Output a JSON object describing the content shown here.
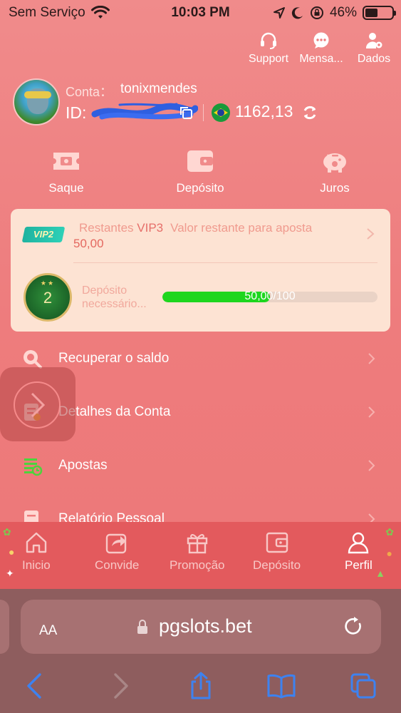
{
  "status_bar": {
    "carrier": "Sem Serviço",
    "time": "10:03 PM",
    "battery": "46%",
    "battery_level": 0.46
  },
  "top_actions": [
    {
      "label": "Support",
      "icon": "headset-icon"
    },
    {
      "label": "Mensa...",
      "icon": "chat-bubble-icon"
    },
    {
      "label": "Dados",
      "icon": "user-settings-icon"
    }
  ],
  "profile": {
    "account_label": "Conta：",
    "account_name": "tonixmendes",
    "id_label": "ID: ",
    "balance": "1162,13",
    "currency_flag": "brazil-flag-icon"
  },
  "quick_actions": [
    {
      "label": "Saque",
      "icon": "ticket-icon"
    },
    {
      "label": "Depósito",
      "icon": "wallet-icon"
    },
    {
      "label": "Juros",
      "icon": "piggy-bank-icon"
    }
  ],
  "vip": {
    "badge": "VIP2",
    "remaining_label": "Restantes",
    "next_level": "VIP3",
    "bet_label": "Valor restante para aposta",
    "amount": "50,00",
    "medal_level": "2",
    "deposit_label": "Depósito necessário...",
    "progress_text": "50,00/100",
    "progress_fraction": 0.5
  },
  "menu": [
    {
      "label": "Recuperar o saldo",
      "icon": "search-coin-icon"
    },
    {
      "label": "Detalhes da Conta",
      "icon": "document-icon"
    },
    {
      "label": "Apostas",
      "icon": "bets-list-icon"
    },
    {
      "label": "Relatório Pessoal",
      "icon": "report-icon"
    }
  ],
  "bottom_nav": [
    {
      "label": "Inicio",
      "icon": "home-icon"
    },
    {
      "label": "Convide",
      "icon": "share-icon"
    },
    {
      "label": "Promoção",
      "icon": "gift-icon"
    },
    {
      "label": "Depósito",
      "icon": "wallet-icon"
    },
    {
      "label": "Perfil",
      "icon": "profile-icon"
    }
  ],
  "browser": {
    "text_size": "AA",
    "url": "pgslots.bet"
  },
  "colors": {
    "background": "#ef7b7c",
    "bottom_nav": "#e35a5d",
    "vip_card": "#fde3d3",
    "progress": "#1ed61e",
    "browser_chrome": "#8e5d5e"
  }
}
